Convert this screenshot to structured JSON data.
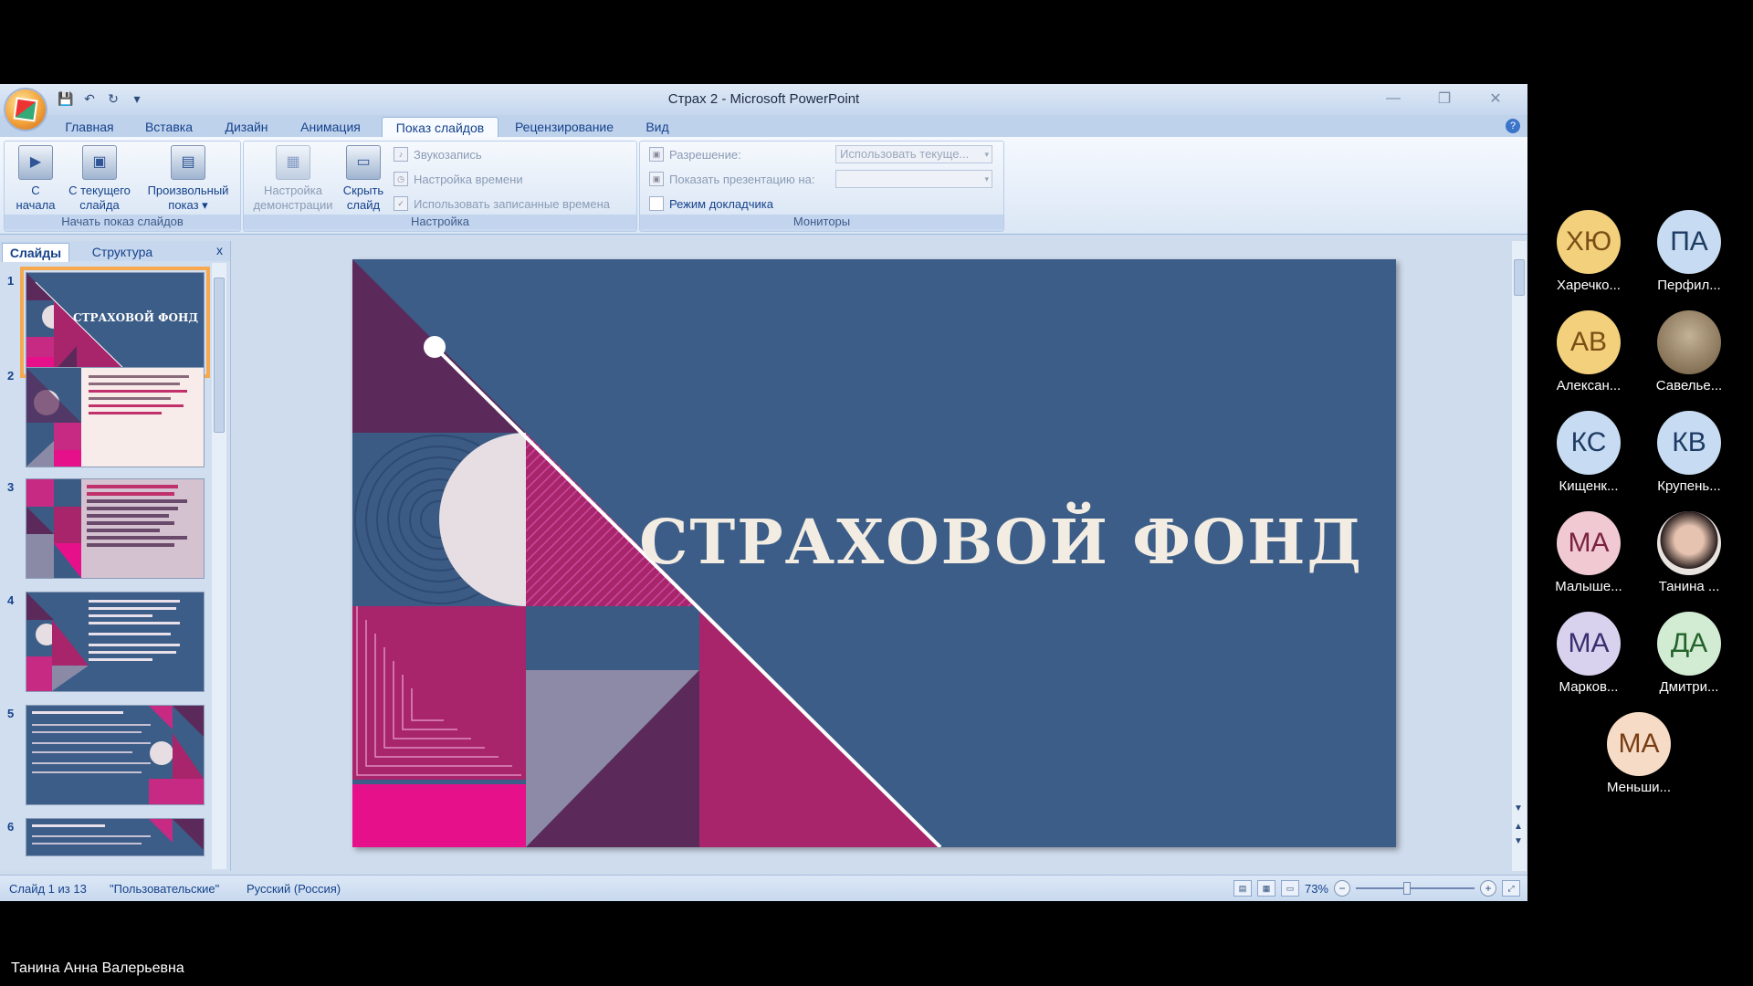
{
  "window": {
    "title": "Страх 2 - Microsoft PowerPoint",
    "controls": [
      "—",
      "❐",
      "✕"
    ]
  },
  "ribbon": {
    "tabs": [
      "Главная",
      "Вставка",
      "Дизайн",
      "Анимация",
      "Показ слайдов",
      "Рецензирование",
      "Вид"
    ],
    "active_tab": "Показ слайдов",
    "groups": {
      "start": {
        "label": "Начать показ слайдов",
        "buttons": [
          {
            "line1": "С",
            "line2": "начала"
          },
          {
            "line1": "С текущего",
            "line2": "слайда"
          },
          {
            "line1": "Произвольный",
            "line2": "показ ▾"
          }
        ]
      },
      "setup": {
        "label": "Настройка",
        "buttons": [
          {
            "line1": "Настройка",
            "line2": "демонстрации"
          },
          {
            "line1": "Скрыть",
            "line2": "слайд"
          }
        ],
        "options": [
          "Звукозапись",
          "Настройка времени",
          "Использовать записанные времена"
        ]
      },
      "monitors": {
        "label": "Мониторы",
        "resolution_label": "Разрешение:",
        "resolution_value": "Использовать текуще...",
        "show_on_label": "Показать презентацию на:",
        "show_on_value": "",
        "presenter_view": "Режим докладчика"
      }
    }
  },
  "slides_panel": {
    "tabs": [
      "Слайды",
      "Структура"
    ],
    "close": "x",
    "thumbs": [
      {
        "num": "1",
        "title": "СТРАХОВОЙ ФОНД"
      },
      {
        "num": "2"
      },
      {
        "num": "3"
      },
      {
        "num": "4"
      },
      {
        "num": "5"
      },
      {
        "num": "6"
      }
    ]
  },
  "slide": {
    "title": "СТРАХОВОЙ ФОНД"
  },
  "status": {
    "slide_info": "Слайд 1 из 13",
    "theme": "\"Пользовательские\"",
    "language": "Русский (Россия)",
    "zoom": "73%"
  },
  "participants": [
    {
      "initials": "ХЮ",
      "name": "Харечко...",
      "bg": "#f3d07c",
      "fg": "#7a4e14"
    },
    {
      "initials": "ПА",
      "name": "Перфил...",
      "bg": "#c7dcf2",
      "fg": "#1e3b63"
    },
    {
      "initials": "АВ",
      "name": "Алексан...",
      "bg": "#f3d07c",
      "fg": "#7a4e14"
    },
    {
      "initials": "",
      "name": "Савелье...",
      "bg": "#8c7a5e",
      "fg": "#fff"
    },
    {
      "initials": "КС",
      "name": "Кищенк...",
      "bg": "#c7dcf2",
      "fg": "#1e3b63"
    },
    {
      "initials": "КВ",
      "name": "Крупень...",
      "bg": "#c7dcf2",
      "fg": "#1e3b63"
    },
    {
      "initials": "МА",
      "name": "Малыше...",
      "bg": "#f1c9d3",
      "fg": "#7a2340"
    },
    {
      "initials": "",
      "name": "Танина ...",
      "bg": "#e9e3df",
      "fg": "#333"
    },
    {
      "initials": "МА",
      "name": "Марков...",
      "bg": "#d9d2ee",
      "fg": "#3a2e6e"
    },
    {
      "initials": "ДА",
      "name": "Дмитри...",
      "bg": "#d2ecd3",
      "fg": "#23632a"
    },
    {
      "initials": "МА",
      "name": "Меньши...",
      "bg": "#f6dcc7",
      "fg": "#7a3e14"
    }
  ],
  "speaker": "Танина Анна Валерьевна"
}
